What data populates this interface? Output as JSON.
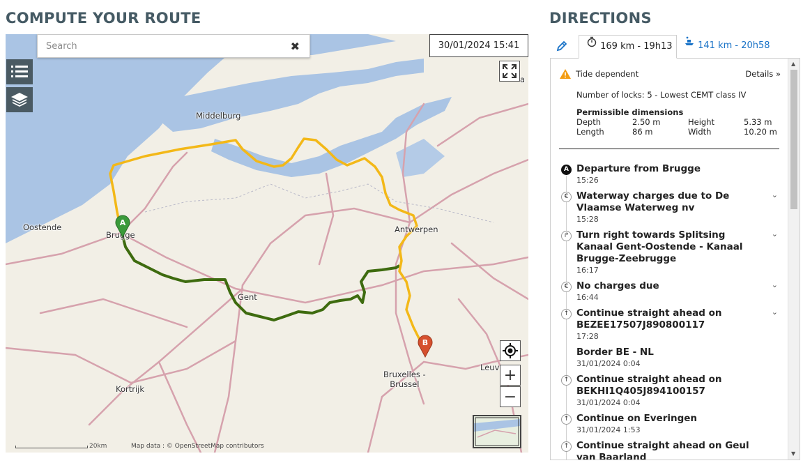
{
  "left": {
    "title": "COMPUTE YOUR ROUTE"
  },
  "right": {
    "title": "DIRECTIONS"
  },
  "search": {
    "placeholder": "Search",
    "clear_glyph": "✖"
  },
  "datetime": "30/01/2024 15:41",
  "icons": [
    "zoom-in-search-icon",
    "list-icon",
    "layers-icon",
    "fullscreen-icon",
    "locate-icon",
    "zoom-in-icon",
    "zoom-out-icon",
    "minimap-icon",
    "edit-pencil-icon",
    "stopwatch-icon",
    "boat-icon",
    "warning-icon"
  ],
  "map": {
    "labels": {
      "middelburg": "Middelburg",
      "oostende": "Oostende",
      "brugge": "Brugge",
      "gent": "Gent",
      "antwerpen": "Antwerpen",
      "kortrijk": "Kortrijk",
      "bruxelles": "Bruxelles -\nBrussel",
      "leuv": "Leuv",
      "edge_a": "a"
    },
    "marker_a": "A",
    "marker_b": "B",
    "zoom_in": "+",
    "zoom_out": "−",
    "scale_label": "20km",
    "attribution": "Map data : © OpenStreetMap contributors",
    "colors": {
      "water": "#aac4e4",
      "land": "#f2efe6",
      "route_yellow": "#f3b818",
      "route_green": "#3e6b0f",
      "roads": "#d6a2ad"
    }
  },
  "directions": {
    "tab_active": "169 km - 19h13",
    "tab_other": "141 km - 20h58",
    "tide": "Tide dependent",
    "details": "Details",
    "locks": "Number of locks: 5 - Lowest CEMT class IV",
    "dim_title": "Permissible dimensions",
    "dims": [
      {
        "label": "Depth",
        "value": "2.50 m",
        "label2": "Height",
        "value2": "5.33 m"
      },
      {
        "label": "Length",
        "value": "86 m",
        "label2": "Width",
        "value2": "10.20 m"
      }
    ],
    "steps": [
      {
        "icon": "A",
        "title": "Departure from Brugge",
        "time": "15:26",
        "expand": false
      },
      {
        "icon": "€",
        "title": "Waterway charges due to De Vlaamse Waterweg nv",
        "time": "15:28",
        "expand": true
      },
      {
        "icon": "↱",
        "title": "Turn right towards Splitsing Kanaal Gent-Oostende - Kanaal Brugge-Zeebrugge",
        "time": "16:17",
        "expand": true
      },
      {
        "icon": "€",
        "title": "No charges due",
        "time": "16:44",
        "expand": true
      },
      {
        "icon": "↑",
        "title": "Continue straight ahead on BEZEE17507J890800117",
        "time": "17:28",
        "expand": true
      },
      {
        "icon": "",
        "title": "Border BE - NL",
        "time": "31/01/2024 0:04",
        "expand": false
      },
      {
        "icon": "↑",
        "title": "Continue straight ahead on BEKHI1Q405J894100157",
        "time": "31/01/2024 0:04",
        "expand": false
      },
      {
        "icon": "↑",
        "title": "Continue on Everingen",
        "time": "31/01/2024 1:53",
        "expand": false
      },
      {
        "icon": "↑",
        "title": "Continue straight ahead on Geul van Baarland",
        "time": "",
        "expand": false
      }
    ]
  }
}
